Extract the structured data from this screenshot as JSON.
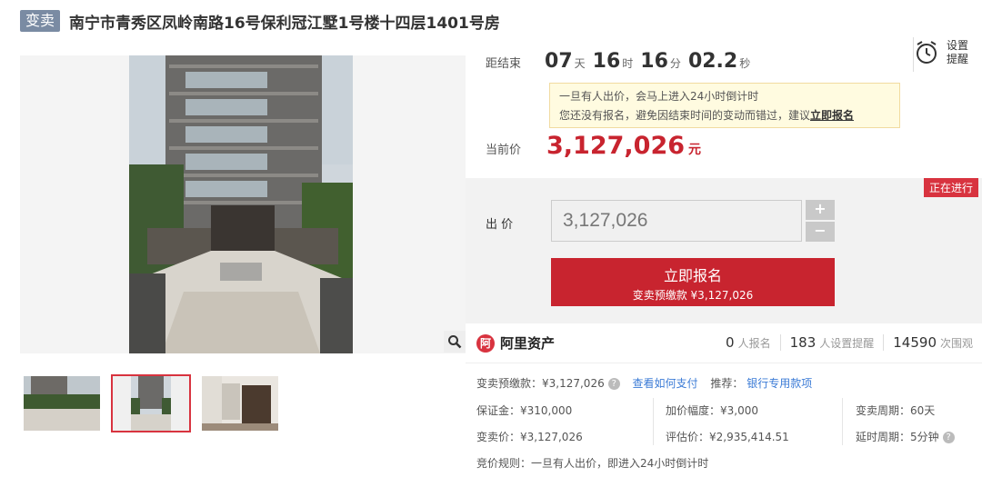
{
  "header": {
    "tag": "变卖",
    "title": "南宁市青秀区凤岭南路16号保利冠江墅1号楼十四层1401号房"
  },
  "countdown": {
    "label": "距结束",
    "days": "07",
    "days_unit": "天",
    "hours": "16",
    "hours_unit": "时",
    "minutes": "16",
    "minutes_unit": "分",
    "seconds": "02.2",
    "seconds_unit": "秒"
  },
  "reminder": {
    "label": "设置提醒",
    "icon": "alarm-clock-icon"
  },
  "notice": {
    "line1": "一旦有人出价，会马上进入24小时倒计时",
    "line2_prefix": "您还没有报名，避免因结束时间的变动而错过，建议",
    "line2_link": "立即报名"
  },
  "current_price": {
    "label": "当前价",
    "value": "3,127,026",
    "unit": "元"
  },
  "bid": {
    "status": "正在进行",
    "label": "出 价",
    "input_value": "3,127,026",
    "plus": "+",
    "minus": "−",
    "signup_label": "立即报名",
    "signup_sub": "变卖预缴款 ¥3,127,026"
  },
  "brand": {
    "name": "阿里资产",
    "logo": "ali-assets-logo"
  },
  "stats": [
    {
      "num": "0",
      "label": "人报名"
    },
    {
      "num": "183",
      "label": "人设置提醒"
    },
    {
      "num": "14590",
      "label": "次围观"
    }
  ],
  "info": {
    "deposit": "变卖预缴款：¥3,127,026",
    "how_to_pay": "查看如何支付",
    "recommend_label": "推荐：",
    "recommend_link": "银行专用款项",
    "margin": "保证金：¥310,000",
    "increment": "加价幅度：¥3,000",
    "period": "变卖周期：60天",
    "sale_price": "变卖价：¥3,127,026",
    "appraisal": "评估价：¥2,935,414.51",
    "delay": "延时周期：5分钟",
    "rule": "竞价规则：一旦有人出价，即进入24小时倒计时"
  },
  "colors": {
    "accent": "#c8242f",
    "tag_bg": "#7a8ba3",
    "link": "#3b7bd6"
  }
}
